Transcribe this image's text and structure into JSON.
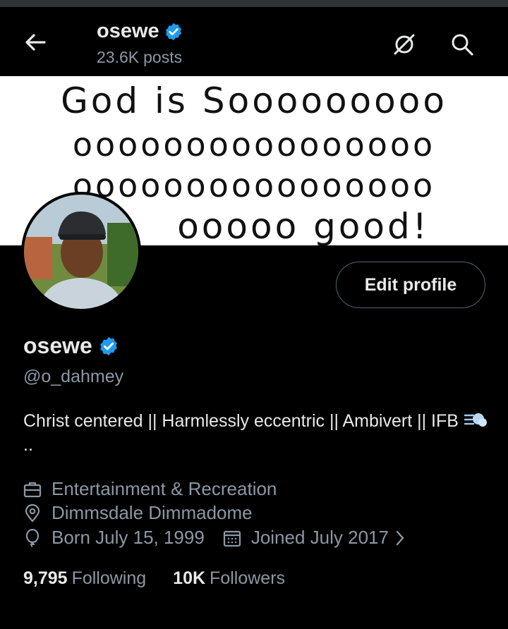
{
  "header": {
    "name": "osewe",
    "posts_count": "23.6K",
    "posts_label": "posts"
  },
  "banner": {
    "lines": [
      "God is Sooooooooo",
      "oooooooooooooooo",
      "oooooooooooooooo",
      "ooooo good!"
    ]
  },
  "profile": {
    "edit_label": "Edit profile",
    "name": "osewe",
    "handle": "@o_dahmey",
    "bio": "Christ centered || Harmlessly eccentric || Ambivert || IFB",
    "bio_tail": "..",
    "category": "Entertainment & Recreation",
    "location": "Dimmsdale Dimmadome",
    "birthday": "Born July 15, 1999",
    "joined": "Joined July 2017",
    "following_count": "9,795",
    "following_label": "Following",
    "followers_count": "10K",
    "followers_label": "Followers"
  },
  "colors": {
    "background": "#000000",
    "text": "#e7e9ea",
    "muted": "#8b98a5",
    "verified": "#1d9bf0",
    "border": "#536471"
  },
  "icons": [
    "back-arrow-icon",
    "verified-badge-icon",
    "grok-icon",
    "search-icon",
    "briefcase-icon",
    "location-pin-icon",
    "balloon-icon",
    "calendar-icon",
    "chevron-right-icon",
    "dash-wind-emoji-icon"
  ]
}
